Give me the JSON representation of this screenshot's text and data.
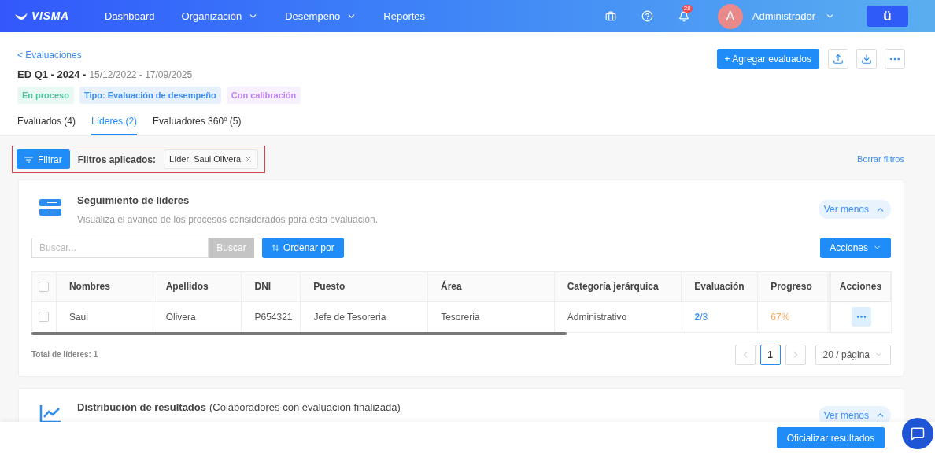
{
  "nav": {
    "brand": "VISMA",
    "items": [
      {
        "label": "Dashboard",
        "dropdown": false
      },
      {
        "label": "Organización",
        "dropdown": true
      },
      {
        "label": "Desempeño",
        "dropdown": true
      },
      {
        "label": "Reportes",
        "dropdown": false
      }
    ],
    "notifications": "28",
    "avatar": "A",
    "user": "Administrador",
    "app_badge": "ü"
  },
  "back_link": "< Evaluaciones",
  "title": {
    "name": "ED Q1 - 2024 -",
    "dates": "15/12/2022 - 17/09/2025"
  },
  "tags": [
    {
      "label": "En proceso",
      "color": "#52c4a0"
    },
    {
      "label": "Tipo: Evaluación de desempeño",
      "color": "#3d8ff0"
    },
    {
      "label": "Con calibración",
      "color": "#c183f5"
    }
  ],
  "actions": {
    "add": "+ Agregar evaluados"
  },
  "tabs": [
    {
      "label": "Evaluados (4)",
      "selected": false
    },
    {
      "label": "Líderes (2)",
      "selected": true
    },
    {
      "label": "Evaluadores 360º (5)",
      "selected": false
    }
  ],
  "filter": {
    "button": "Filtrar",
    "applied_label": "Filtros aplicados:",
    "chips": [
      "Líder: Saul Olivera"
    ],
    "clear": "Borrar filtros"
  },
  "leaders_card": {
    "title": "Seguimiento de líderes",
    "subtitle": "Visualiza el avance de los procesos considerados para esta evaluación.",
    "toggle": "Ver menos",
    "search": {
      "placeholder": "Buscar...",
      "button": "Buscar"
    },
    "sort": "Ordenar por",
    "actions": "Acciones",
    "table": {
      "header_checked": false,
      "columns": [
        "Nombres",
        "Apellidos",
        "DNI",
        "Puesto",
        "Área",
        "Categoría jerárquica",
        "Evaluación",
        "Progreso",
        "Acciones"
      ],
      "rows": [
        {
          "checked": false,
          "cells": [
            "Saul",
            "Olivera",
            "P654321",
            "Jefe de Tesoreria",
            "Tesoreria",
            "Administrativo",
            "**2**/3",
            "67%"
          ]
        }
      ]
    },
    "total": "Total de líderes: 1",
    "pagination": {
      "pages": [
        {
          "label": "1",
          "selected": true
        }
      ],
      "page_size": "20 / página"
    }
  },
  "distribution_card": {
    "title": "Distribución de resultados",
    "note": "(Colaboradores con evaluación finalizada)",
    "toggle": "Ver menos"
  },
  "footer": {
    "button": "Oficializar resultados"
  }
}
